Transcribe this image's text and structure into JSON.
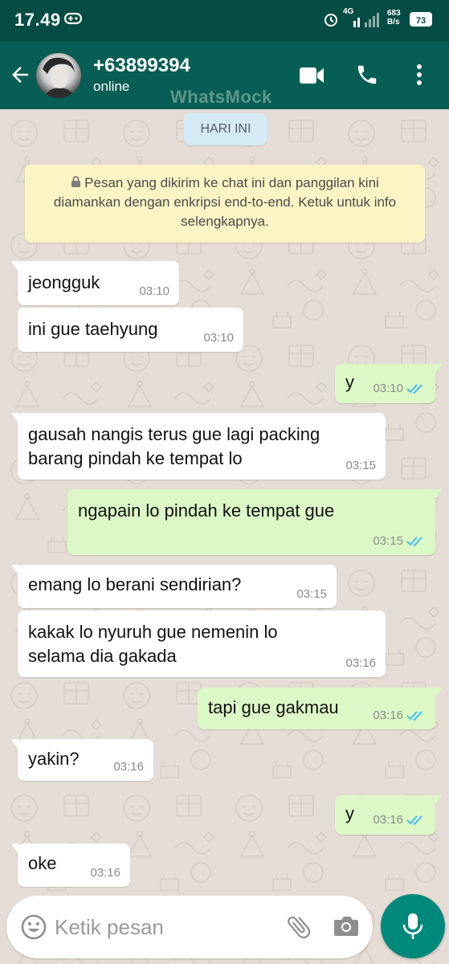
{
  "status_bar": {
    "time": "17.49",
    "network": "4G",
    "speed_value": "683",
    "speed_unit": "B/s",
    "battery": "73"
  },
  "header": {
    "contact_name": "+63899394",
    "contact_status": "online",
    "watermark": "WhatsMock"
  },
  "date_chip": "HARI INI",
  "encryption_notice": "Pesan yang dikirim ke chat ini dan panggilan kini diamankan dengan enkripsi end-to-end. Ketuk untuk info selengkapnya.",
  "messages": [
    {
      "direction": "in",
      "text": "jeongguk",
      "time": "03:10"
    },
    {
      "direction": "in",
      "text": "ini gue taehyung",
      "time": "03:10"
    },
    {
      "direction": "out",
      "text": "y",
      "time": "03:10",
      "read": true
    },
    {
      "direction": "in",
      "text": "gausah nangis terus gue lagi packing\nbarang pindah ke tempat lo",
      "time": "03:15"
    },
    {
      "direction": "out",
      "text": "ngapain lo pindah ke tempat gue",
      "time": "03:15",
      "read": true
    },
    {
      "direction": "in",
      "text": "emang lo berani sendirian?",
      "time": "03:15"
    },
    {
      "direction": "in",
      "text": "kakak lo nyuruh gue nemenin lo\nselama dia gakada",
      "time": "03:16"
    },
    {
      "direction": "out",
      "text": "tapi gue gakmau",
      "time": "03:16",
      "read": true
    },
    {
      "direction": "in",
      "text": "yakin?",
      "time": "03:16"
    },
    {
      "direction": "out",
      "text": "y",
      "time": "03:16",
      "read": true
    },
    {
      "direction": "in",
      "text": "oke",
      "time": "03:16"
    }
  ],
  "composer": {
    "placeholder": "Ketik pesan"
  },
  "colors": {
    "header": "#075e54",
    "status_bar": "#054d44",
    "outgoing_bubble": "#dcf8c6",
    "incoming_bubble": "#ffffff",
    "read_ticks": "#34b7f1",
    "fab": "#00897b"
  },
  "icons": [
    "back-arrow-icon",
    "video-call-icon",
    "phone-icon",
    "more-vert-icon",
    "lock-icon",
    "double-check-icon",
    "emoji-icon",
    "attach-icon",
    "camera-icon",
    "mic-icon"
  ]
}
